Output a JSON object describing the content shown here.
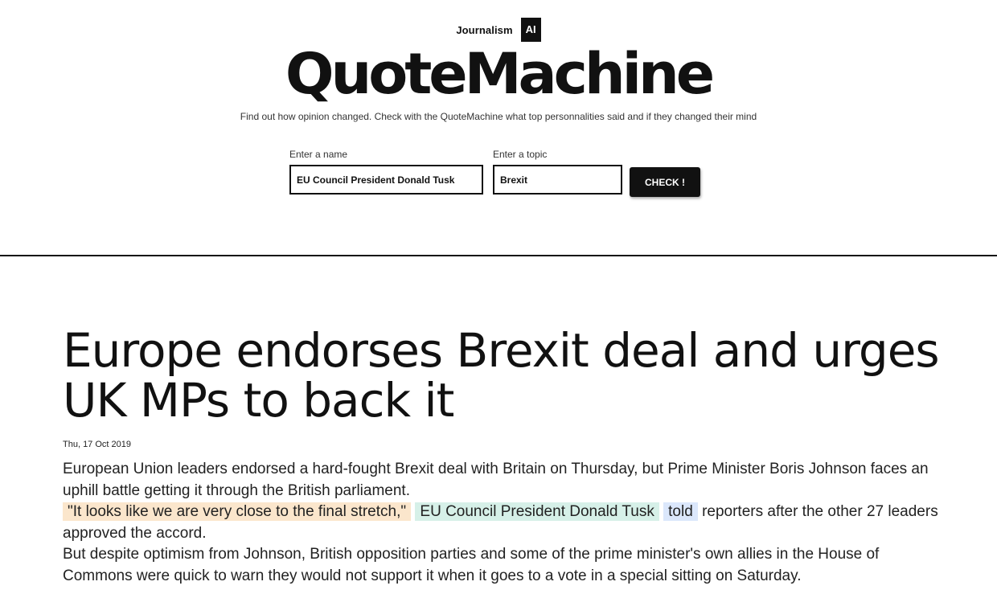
{
  "brand": {
    "journalism": "Journalism",
    "ai_badge": "AI",
    "logo": "QuoteMachine",
    "tagline": "Find out how opinion changed. Check with the QuoteMachine what top personnalities said and if they changed their mind"
  },
  "search": {
    "name_label": "Enter a name",
    "name_value": "EU Council President Donald Tusk",
    "topic_label": "Enter a topic",
    "topic_value": "Brexit",
    "check_button": "CHECK !"
  },
  "article": {
    "title": "Europe endorses Brexit deal and urges UK MPs to back it",
    "date": "Thu, 17 Oct 2019",
    "para1": "European Union leaders endorsed a hard-fought Brexit deal with Britain on Thursday, but Prime Minister Boris Johnson faces an uphill battle getting it through the British parliament.",
    "quote": "\"It looks like we are very close to the final stretch,\"",
    "speaker": "EU Council President Donald Tusk",
    "verb": "told",
    "para2_rest": "reporters after the other 27 leaders approved the accord.",
    "para3": "But despite optimism from Johnson, British opposition parties and some of the prime minister's own allies in the House of Commons were quick to warn they would not support it when it goes to a vote in a special sitting on Saturday."
  },
  "colors": {
    "quote_highlight": "#fbe6cc",
    "speaker_highlight": "#d6f0e8",
    "verb_highlight": "#dbe7fb",
    "accent": "#111111"
  }
}
